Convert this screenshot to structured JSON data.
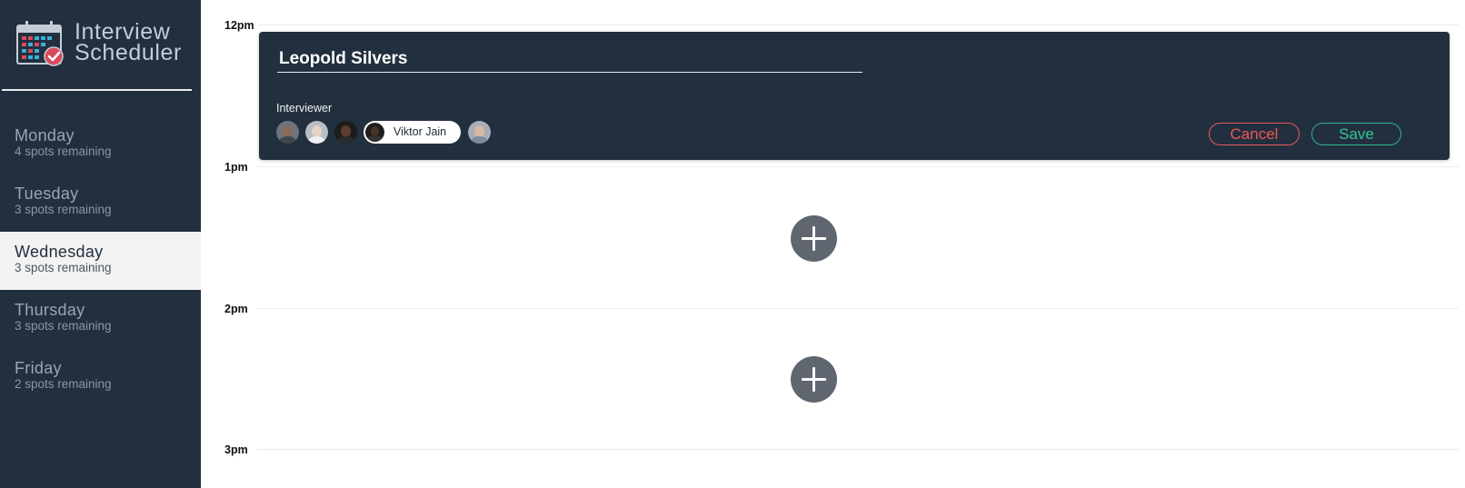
{
  "app": {
    "title_line1": "Interview",
    "title_line2": "Scheduler",
    "logo_icon": "calendar-check-icon"
  },
  "days": [
    {
      "name": "Monday",
      "spots": "4 spots remaining",
      "selected": false
    },
    {
      "name": "Tuesday",
      "spots": "3 spots remaining",
      "selected": false
    },
    {
      "name": "Wednesday",
      "spots": "3 spots remaining",
      "selected": true
    },
    {
      "name": "Thursday",
      "spots": "3 spots remaining",
      "selected": false
    },
    {
      "name": "Friday",
      "spots": "2 spots remaining",
      "selected": false
    }
  ],
  "schedule": {
    "times": [
      "12pm",
      "1pm",
      "2pm",
      "3pm"
    ]
  },
  "form": {
    "student_name": "Leopold Silvers",
    "interviewer_label": "Interviewer",
    "selected_interviewer": "Viktor Jain",
    "cancel_label": "Cancel",
    "save_label": "Save"
  },
  "colors": {
    "sidebar_bg": "#222f3e",
    "selected_day_bg": "#f2f2f2",
    "cancel": "#ef5757",
    "save": "#31c596",
    "add_button": "#5f6670"
  }
}
